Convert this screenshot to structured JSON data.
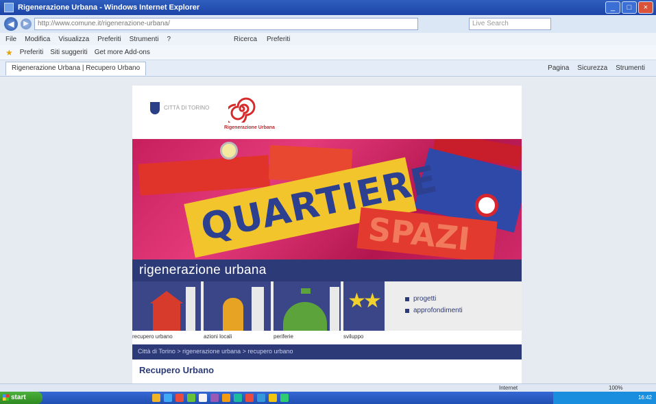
{
  "window": {
    "title": "Rigenerazione Urbana - Windows Internet Explorer"
  },
  "addressbar": {
    "url": "http://www.comune.it/rigenerazione-urbana/",
    "search_placeholder": "Live Search"
  },
  "menubar": {
    "items": [
      "File",
      "Modifica",
      "Visualizza",
      "Preferiti",
      "Strumenti",
      "?"
    ],
    "toolbar_items": [
      "Ricerca",
      "Preferiti"
    ]
  },
  "favbar": {
    "label": "Preferiti",
    "items": [
      "Siti suggeriti",
      "Get more Add-ons"
    ]
  },
  "tabbar": {
    "tab_label": "Rigenerazione Urbana | Recupero Urbano",
    "commands": [
      "Pagina",
      "Sicurezza",
      "Strumenti"
    ]
  },
  "site": {
    "city_logo_text": "CITTÀ DI TORINO",
    "logo_caption": "Rigenerazione Urbana",
    "banner_words": [
      "QUARTIERE",
      "SPAZI"
    ],
    "title": "rigenerazione urbana",
    "quick_links": [
      "progetti",
      "approfondimenti"
    ],
    "tile_labels": [
      "recupero urbano",
      "azioni locali",
      "periferie",
      "sviluppo"
    ],
    "breadcrumb": "Città di Torino > rigenerazione urbana > recupero urbano",
    "section_title": "Recupero Urbano"
  },
  "statusbar": {
    "zone": "Internet",
    "zoom": "100%"
  },
  "taskbar": {
    "start_label": "start",
    "clock": "16:42"
  },
  "colors": {
    "brand_navy": "#2c3a78",
    "banner_pink": "#c61f5c",
    "accent_yellow": "#f3c52d",
    "accent_red": "#e0342a"
  }
}
